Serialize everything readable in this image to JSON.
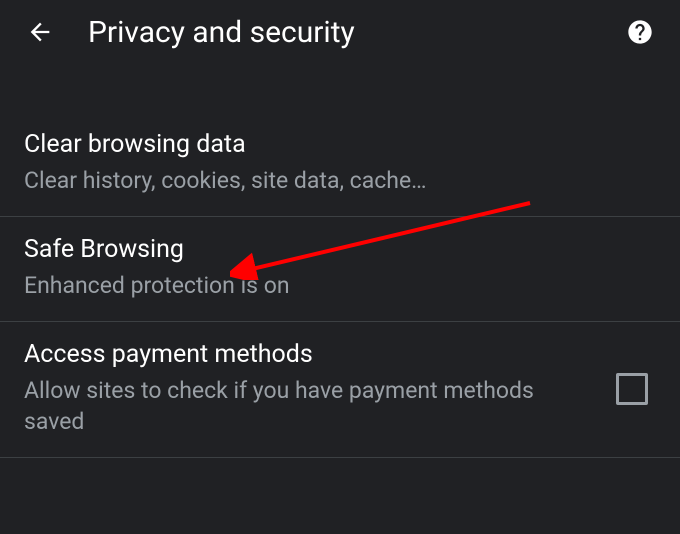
{
  "header": {
    "title": "Privacy and security"
  },
  "settings": {
    "clear_browsing": {
      "title": "Clear browsing data",
      "subtitle": "Clear history, cookies, site data, cache…"
    },
    "safe_browsing": {
      "title": "Safe Browsing",
      "subtitle": "Enhanced protection is on"
    },
    "payment_methods": {
      "title": "Access payment methods",
      "subtitle": "Allow sites to check if you have payment methods saved",
      "checked": false
    }
  }
}
